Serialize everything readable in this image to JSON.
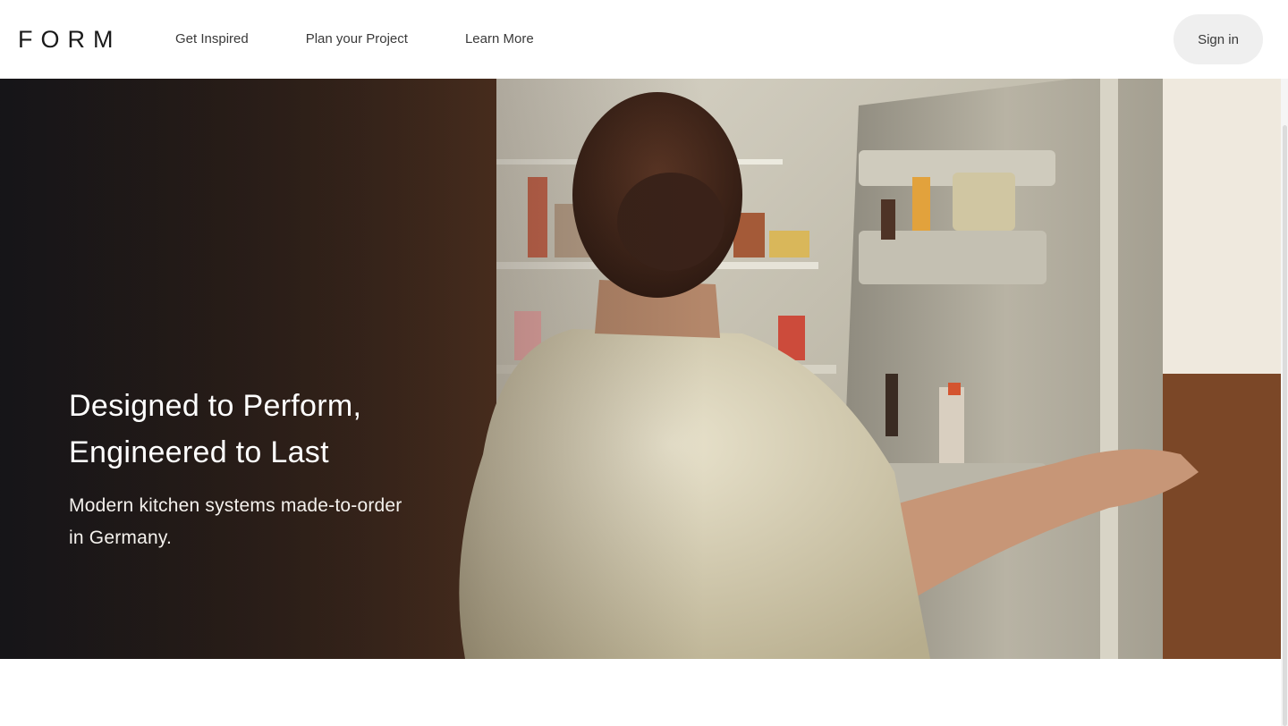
{
  "nav": {
    "logo": "FORM",
    "links": [
      "Get Inspired",
      "Plan your Project",
      "Learn More"
    ],
    "signin_label": "Sign in"
  },
  "hero": {
    "title_line1": "Designed to Perform,",
    "title_line2": "Engineered to Last",
    "subtitle_line1": "Modern kitchen systems made-to-order",
    "subtitle_line2": "in Germany."
  },
  "colors": {
    "nav_bg": "#ffffff",
    "signin_bg": "#efefef",
    "hero_text": "#ffffff",
    "wood": "#4a2d1c"
  }
}
